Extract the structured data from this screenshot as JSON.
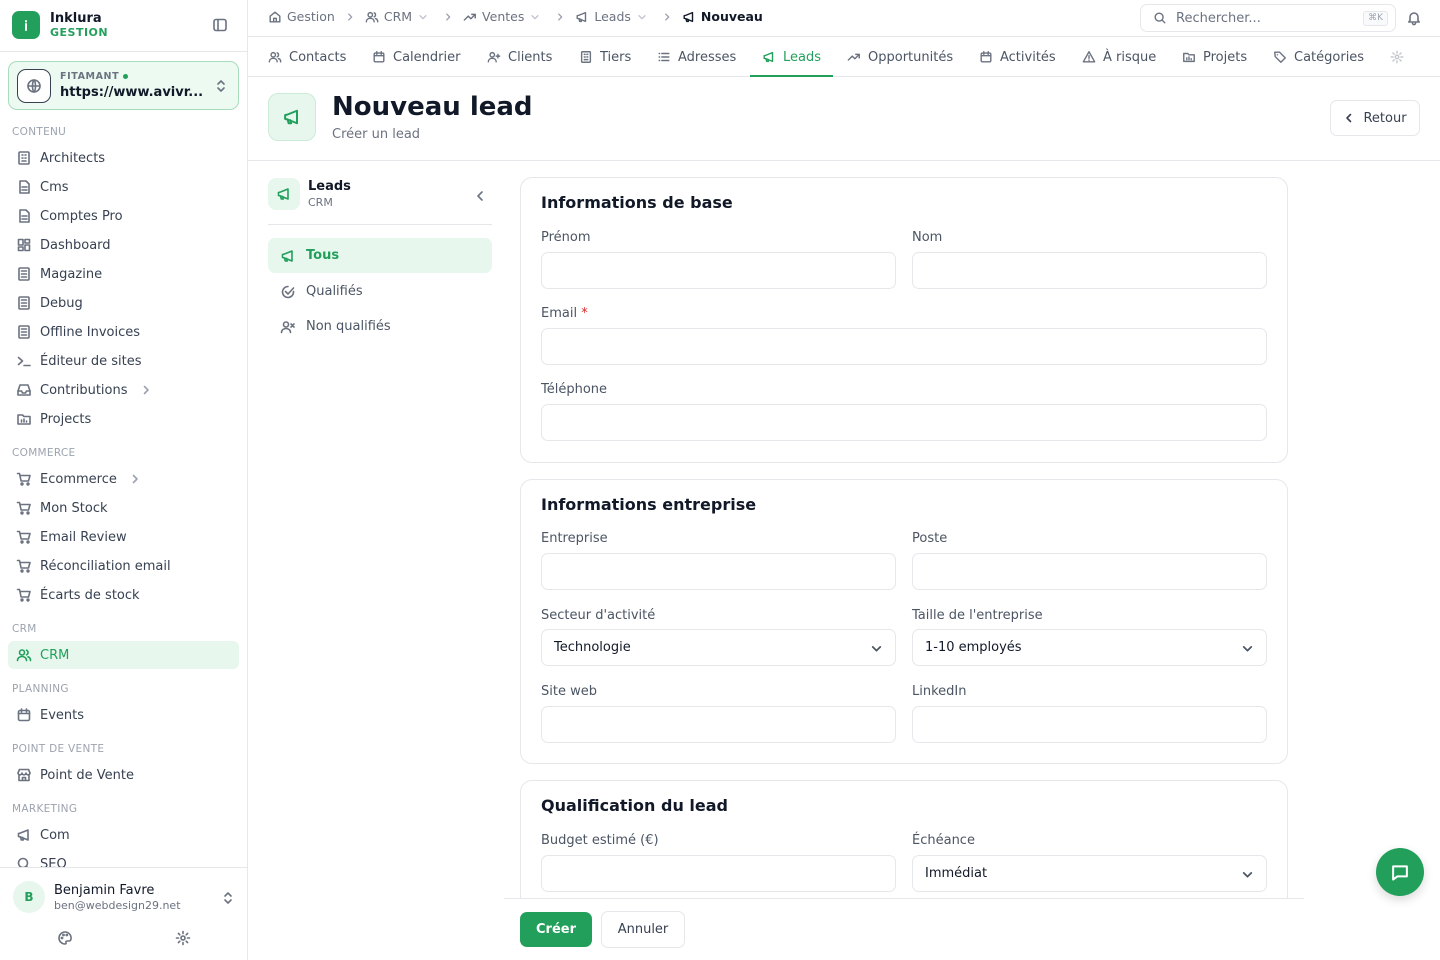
{
  "brand": {
    "name": "Inklura",
    "subtitle": "GESTION"
  },
  "site": {
    "label": "FITAMANT",
    "url": "https://www.avivr..."
  },
  "sidebar": {
    "sections": [
      {
        "label": "CONTENU",
        "items": [
          "Architects",
          "Cms",
          "Comptes Pro",
          "Dashboard",
          "Magazine",
          "Debug",
          "Offline Invoices",
          "Éditeur de sites",
          "Contributions",
          "Projects"
        ]
      },
      {
        "label": "COMMERCE",
        "items": [
          "Ecommerce",
          "Mon Stock",
          "Email Review",
          "Réconciliation email",
          "Écarts de stock"
        ]
      },
      {
        "label": "CRM",
        "items": [
          "CRM"
        ]
      },
      {
        "label": "PLANNING",
        "items": [
          "Events"
        ]
      },
      {
        "label": "POINT DE VENTE",
        "items": [
          "Point de Vente"
        ]
      },
      {
        "label": "MARKETING",
        "items": [
          "Com",
          "SEO"
        ]
      }
    ],
    "active_item": "CRM"
  },
  "user": {
    "initial": "B",
    "name": "Benjamin Favre",
    "email": "ben@webdesign29.net"
  },
  "breadcrumb": [
    "Gestion",
    "CRM",
    "Ventes",
    "Leads",
    "Nouveau"
  ],
  "search": {
    "placeholder": "Rechercher...",
    "shortcut": "⌘K"
  },
  "tabs": [
    "Contacts",
    "Calendrier",
    "Clients",
    "Tiers",
    "Adresses",
    "Leads",
    "Opportunités",
    "Activités",
    "À risque",
    "Projets",
    "Catégories"
  ],
  "active_tab": "Leads",
  "header": {
    "title": "Nouveau lead",
    "subtitle": "Créer un lead",
    "back_label": "Retour"
  },
  "subnav": {
    "title": "Leads",
    "caption": "CRM",
    "items": [
      "Tous",
      "Qualifiés",
      "Non qualifiés"
    ],
    "active": "Tous"
  },
  "form": {
    "basic": {
      "title": "Informations de base",
      "first_name_label": "Prénom",
      "last_name_label": "Nom",
      "email_label": "Email",
      "required_mark": "*",
      "phone_label": "Téléphone"
    },
    "company": {
      "title": "Informations entreprise",
      "company_label": "Entreprise",
      "position_label": "Poste",
      "sector_label": "Secteur d'activité",
      "sector_value": "Technologie",
      "size_label": "Taille de l'entreprise",
      "size_value": "1-10 employés",
      "website_label": "Site web",
      "linkedin_label": "LinkedIn"
    },
    "qualification": {
      "title": "Qualification du lead",
      "budget_label": "Budget estimé (€)",
      "deadline_label": "Échéance",
      "deadline_value": "Immédiat"
    }
  },
  "actions": {
    "create_label": "Créer",
    "cancel_label": "Annuler"
  },
  "colors": {
    "accent": "#22a05b",
    "accent_bg": "#e7f7ee",
    "border": "#e5e7eb"
  }
}
